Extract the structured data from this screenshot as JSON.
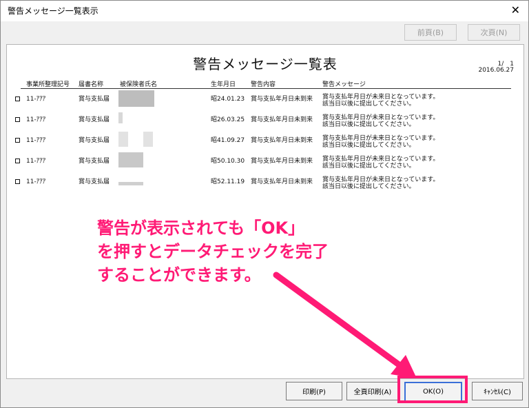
{
  "window": {
    "title": "警告メッセージ一覧表示",
    "close_glyph": "✕"
  },
  "nav": {
    "prev_label": "前頁(B)",
    "next_label": "次頁(N)"
  },
  "report": {
    "title": "警告メッセージ一覧表",
    "page": "1/　1",
    "date": "2016.06.27",
    "headers": [
      "事業所整理記号",
      "届書名称",
      "被保険者氏名",
      "生年月日",
      "警告内容",
      "警告メッセージ"
    ],
    "rows": [
      {
        "code": "11-ｱｱｱ",
        "form": "賞与支払届",
        "birth": "昭24.01.23",
        "warning": "賞与支払年月日未到来",
        "msg1": "賞与支払年月日が未来日となっています。",
        "msg2": "該当日以後に提出してください。"
      },
      {
        "code": "11-ｱｱｱ",
        "form": "賞与支払届",
        "birth": "昭26.03.25",
        "warning": "賞与支払年月日未到来",
        "msg1": "賞与支払年月日が未来日となっています。",
        "msg2": "該当日以後に提出してください。"
      },
      {
        "code": "11-ｱｱｱ",
        "form": "賞与支払届",
        "birth": "昭41.09.27",
        "warning": "賞与支払年月日未到来",
        "msg1": "賞与支払年月日が未来日となっています。",
        "msg2": "該当日以後に提出してください。"
      },
      {
        "code": "11-ｱｱｱ",
        "form": "賞与支払届",
        "birth": "昭50.10.30",
        "warning": "賞与支払年月日未到来",
        "msg1": "賞与支払年月日が未来日となっています。",
        "msg2": "該当日以後に提出してください。"
      },
      {
        "code": "11-ｱｱｱ",
        "form": "賞与支払届",
        "birth": "昭52.11.19",
        "warning": "賞与支払年月日未到来",
        "msg1": "賞与支払年月日が未来日となっています。",
        "msg2": "該当日以後に提出してください。"
      }
    ]
  },
  "annotation": {
    "line1": "警告が表示されても「OK」",
    "line2": "を押すとデータチェックを完了",
    "line3": "することができます。",
    "color": "#ff1a75"
  },
  "buttons": {
    "print": "印刷(P)",
    "print_all": "全頁印刷(A)",
    "ok": "OK(O)",
    "cancel": "ｷｬﾝｾﾙ(C)"
  }
}
